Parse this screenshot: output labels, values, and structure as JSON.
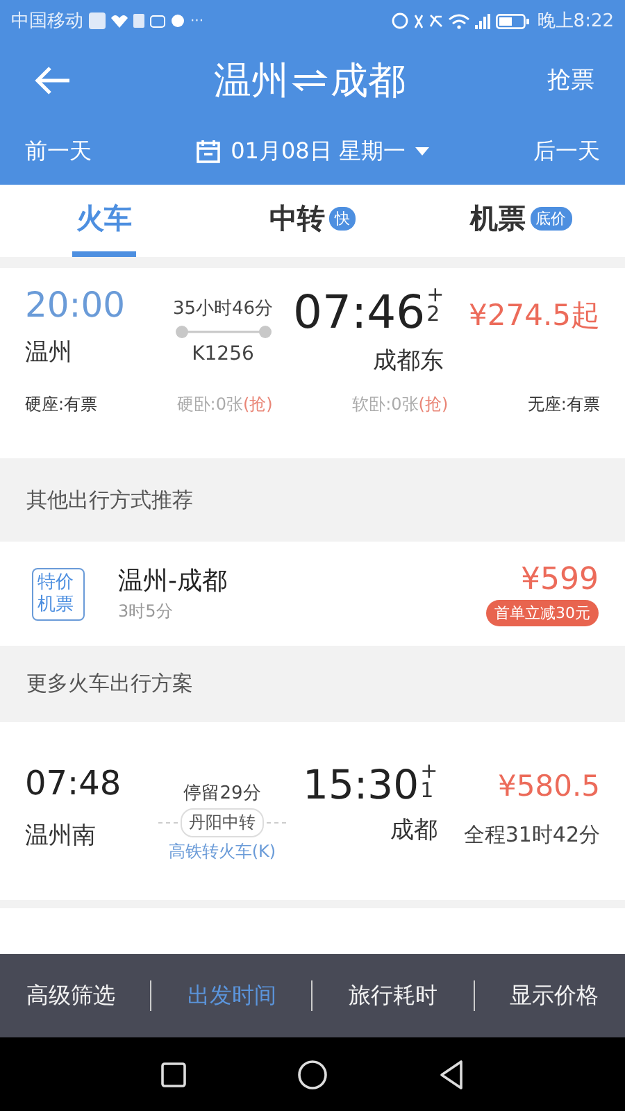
{
  "status_bar": {
    "carrier": "中国移动",
    "more": "···",
    "time": "晚上8:22"
  },
  "header": {
    "from": "温州",
    "to": "成都",
    "action": "抢票"
  },
  "date_bar": {
    "prev": "前一天",
    "date": "01月08日 星期一",
    "next": "后一天"
  },
  "tabs": [
    {
      "label": "火车",
      "selected": true
    },
    {
      "label": "中转",
      "badge": "快",
      "selected": false
    },
    {
      "label": "机票",
      "badge": "底价",
      "selected": false
    }
  ],
  "train": {
    "depart_time": "20:00",
    "depart_station": "温州",
    "duration": "35小时46分",
    "train_no": "K1256",
    "arrive_time": "07:46",
    "arrive_sign": "+",
    "arrive_days": "2",
    "arrive_station": "成都东",
    "price": "¥274.5起",
    "seats": [
      {
        "label": "硬座:有票",
        "available": true
      },
      {
        "label": "硬卧:0张",
        "available": false,
        "grab": "(抢)"
      },
      {
        "label": "软卧:0张",
        "available": false,
        "grab": "(抢)"
      },
      {
        "label": "无座:有票",
        "available": true
      }
    ]
  },
  "other_heading": "其他出行方式推荐",
  "flight": {
    "tag": "特价机票",
    "route": "温州-成都",
    "duration": "3时5分",
    "price": "¥599",
    "promo": "首单立减30元"
  },
  "more_heading": "更多火车出行方案",
  "transfer": {
    "depart_time": "07:48",
    "depart_station": "温州南",
    "stop": "停留29分",
    "via": "丹阳中转",
    "mode": "高铁转火车(K)",
    "arrive_time": "15:30",
    "arrive_sign": "+",
    "arrive_days": "1",
    "arrive_station": "成都",
    "price": "¥580.5",
    "total": "全程31时42分"
  },
  "bottom_bar": [
    {
      "label": "高级筛选",
      "selected": false
    },
    {
      "label": "出发时间",
      "selected": true
    },
    {
      "label": "旅行耗时",
      "selected": false
    },
    {
      "label": "显示价格",
      "selected": false
    }
  ]
}
